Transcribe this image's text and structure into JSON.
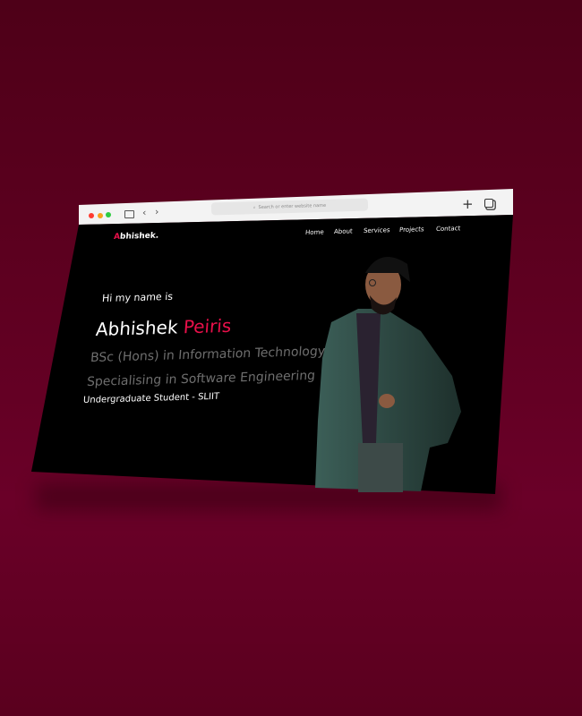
{
  "browser": {
    "url_placeholder": "Search or enter website name",
    "icons": [
      "close-dot",
      "minimize-dot",
      "maximize-dot",
      "sidebar-icon",
      "back-icon",
      "forward-icon",
      "search-icon",
      "new-tab-icon",
      "tabs-overview-icon"
    ]
  },
  "site": {
    "logo_initial": "A",
    "logo_rest": "bhishek.",
    "nav": [
      "Home",
      "About",
      "Services",
      "Projects",
      "Contact"
    ],
    "greeting": "Hi my name is",
    "first_name": "Abhishek",
    "last_name": "Peiris",
    "degree": "BSc (Hons) in Information Technology",
    "specialisation": "Specialising in Software Engineering",
    "status": "Undergraduate Student - SLIIT"
  },
  "colors": {
    "accent": "#e8104a",
    "background": "#5e0020"
  }
}
